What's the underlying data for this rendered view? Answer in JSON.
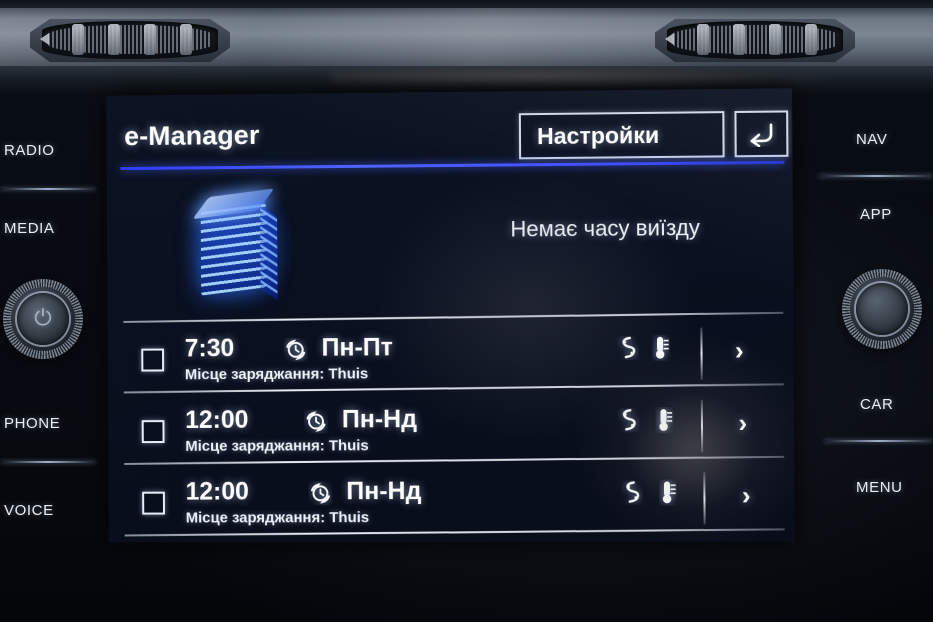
{
  "dashboard": {
    "vent_left_name": "air-vent-left",
    "vent_right_name": "air-vent-right"
  },
  "left_buttons": [
    {
      "label": "RADIO"
    },
    {
      "label": "MEDIA"
    },
    {
      "label": "PHONE"
    },
    {
      "label": "VOICE"
    }
  ],
  "right_buttons": [
    {
      "label": "NAV"
    },
    {
      "label": "APP"
    },
    {
      "label": "CAR"
    },
    {
      "label": "MENU"
    }
  ],
  "knobs": {
    "left_label": "power-volume-knob",
    "left_glyph": "⏻",
    "right_label": "tune-knob"
  },
  "screen": {
    "title": "e-Manager",
    "settings_label": "Настройки",
    "back_icon": "back-arrow-icon",
    "accent_color": "#3b4bff",
    "notice": "Немає часу виїзду",
    "battery_icon": "battery-stack-icon",
    "timers": [
      {
        "checked": false,
        "time": "7:30",
        "repeat_icon": "repeat-clock-icon",
        "days": "Пн-Пт",
        "subtitle": "Місце заряджання: Thuis",
        "charge_icon": "charging-plug-icon",
        "climate_icon": "thermometer-icon",
        "chevron": "›"
      },
      {
        "checked": false,
        "time": "12:00",
        "repeat_icon": "repeat-clock-icon",
        "days": "Пн-Нд",
        "subtitle": "Місце заряджання: Thuis",
        "charge_icon": "charging-plug-icon",
        "climate_icon": "thermometer-icon",
        "chevron": "›"
      },
      {
        "checked": false,
        "time": "12:00",
        "repeat_icon": "repeat-clock-icon",
        "days": "Пн-Нд",
        "subtitle": "Місце заряджання: Thuis",
        "charge_icon": "charging-plug-icon",
        "climate_icon": "thermometer-icon",
        "chevron": "›"
      }
    ]
  }
}
